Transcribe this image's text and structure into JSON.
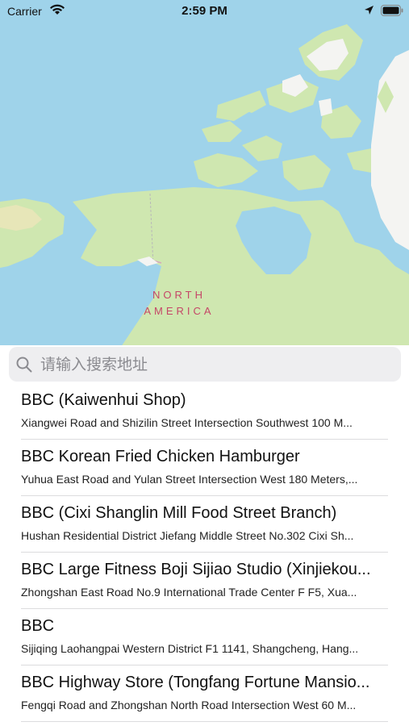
{
  "status_bar": {
    "carrier": "Carrier",
    "time": "2:59 PM"
  },
  "map": {
    "labels": {
      "line1": "NORTH",
      "line2": "AMERICA"
    },
    "colors": {
      "water": "#9fd3ea",
      "land": "#cfe7b0",
      "ice": "#f4f4f2",
      "label": "#c54768"
    }
  },
  "search": {
    "placeholder": "请输入搜索地址",
    "value": ""
  },
  "results": [
    {
      "title": "BBC (Kaiwenhui Shop)",
      "subtitle": "Xiangwei Road and Shizilin Street Intersection Southwest 100 M..."
    },
    {
      "title": "BBC Korean Fried Chicken Hamburger",
      "subtitle": "Yuhua East Road and Yulan Street Intersection West 180 Meters,..."
    },
    {
      "title": "BBC (Cixi Shanglin Mill Food Street Branch)",
      "subtitle": "Hushan Residential District Jiefang Middle Street No.302 Cixi Sh..."
    },
    {
      "title": "BBC Large Fitness Boji Sijiao Studio (Xinjiekou...",
      "subtitle": "Zhongshan East Road No.9 International Trade Center F F5, Xua..."
    },
    {
      "title": "BBC",
      "subtitle": "Sijiqing Laohangpai Western District F1 1141, Shangcheng, Hang..."
    },
    {
      "title": "BBC Highway Store (Tongfang Fortune Mansio...",
      "subtitle": "Fengqi Road and Zhongshan North Road Intersection West 60 M..."
    }
  ]
}
